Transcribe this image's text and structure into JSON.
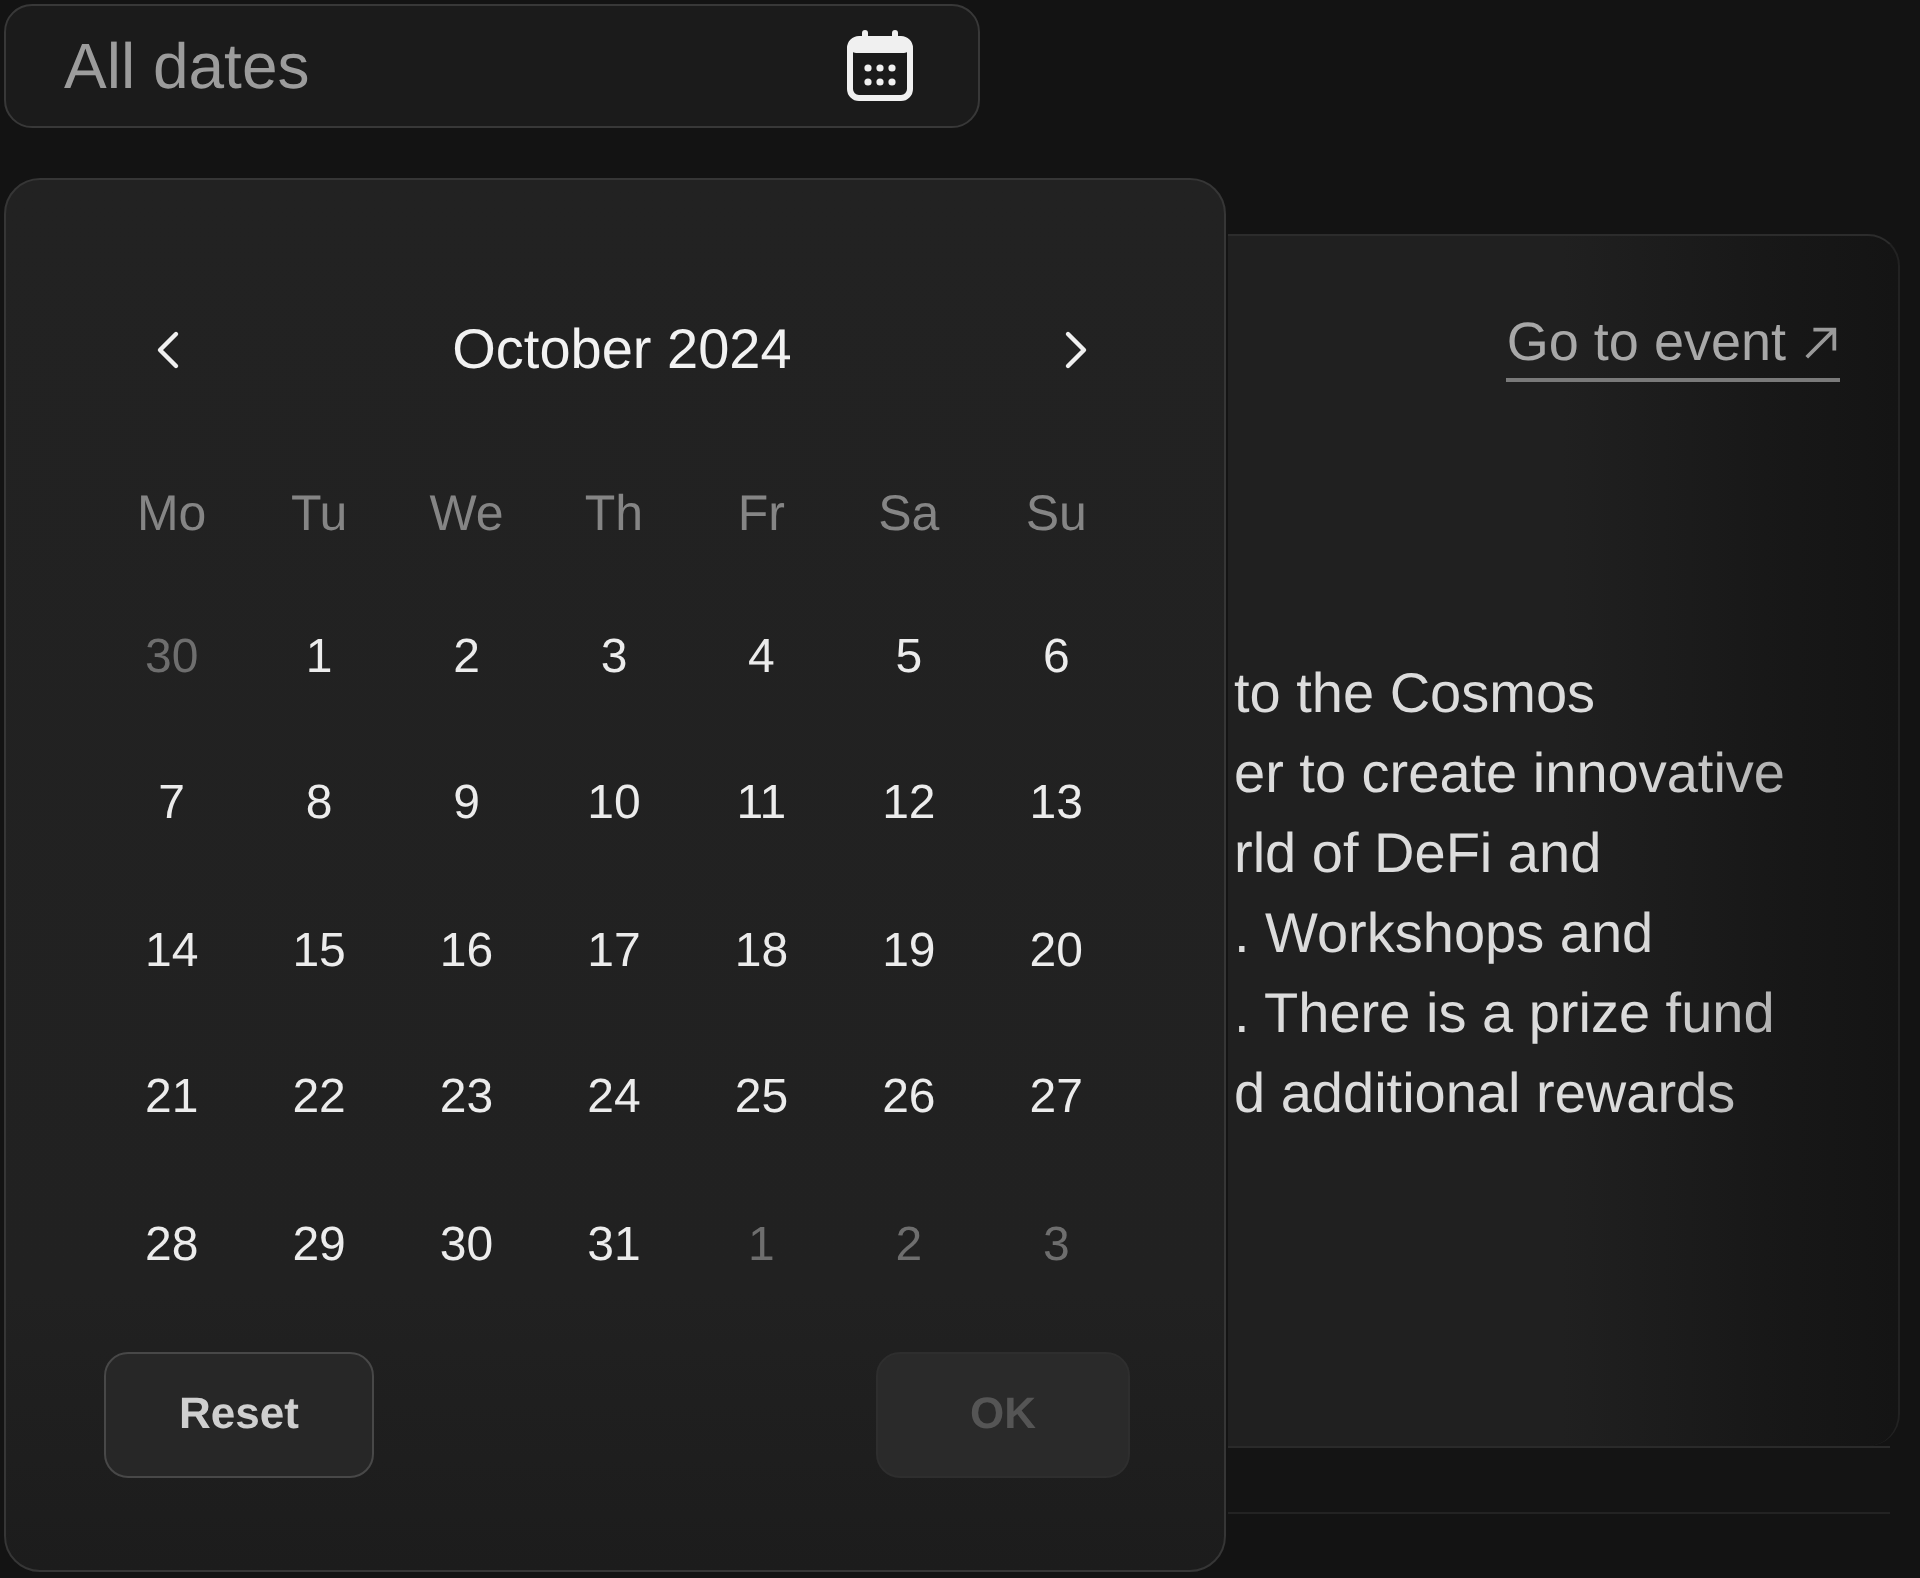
{
  "date_field": {
    "placeholder": "All dates"
  },
  "event_card": {
    "link": "Go to event",
    "description_lines": [
      "to the Cosmos",
      "er to create innovative",
      "rld of DeFi and",
      ". Workshops and",
      ". There is a prize fund",
      "d additional rewards"
    ]
  },
  "calendar": {
    "month": "October 2024",
    "weekdays": [
      "Mo",
      "Tu",
      "We",
      "Th",
      "Fr",
      "Sa",
      "Su"
    ],
    "weeks": [
      {
        "days": [
          {
            "day": "30",
            "in_month": false,
            "selected": false
          },
          {
            "day": "1",
            "in_month": true,
            "selected": false
          },
          {
            "day": "2",
            "in_month": true,
            "selected": false
          },
          {
            "day": "3",
            "in_month": true,
            "selected": false
          },
          {
            "day": "4",
            "in_month": true,
            "selected": false
          },
          {
            "day": "5",
            "in_month": true,
            "selected": false
          },
          {
            "day": "6",
            "in_month": true,
            "selected": false
          }
        ]
      },
      {
        "days": [
          {
            "day": "7",
            "in_month": true,
            "selected": false
          },
          {
            "day": "8",
            "in_month": true,
            "selected": false
          },
          {
            "day": "9",
            "in_month": true,
            "selected": false
          },
          {
            "day": "10",
            "in_month": true,
            "selected": false
          },
          {
            "day": "11",
            "in_month": true,
            "selected": false
          },
          {
            "day": "12",
            "in_month": true,
            "selected": false
          },
          {
            "day": "13",
            "in_month": true,
            "selected": false
          }
        ]
      },
      {
        "days": [
          {
            "day": "14",
            "in_month": true,
            "selected": false
          },
          {
            "day": "15",
            "in_month": true,
            "selected": false
          },
          {
            "day": "16",
            "in_month": true,
            "selected": false
          },
          {
            "day": "17",
            "in_month": true,
            "selected": false
          },
          {
            "day": "18",
            "in_month": true,
            "selected": false
          },
          {
            "day": "19",
            "in_month": true,
            "selected": false
          },
          {
            "day": "20",
            "in_month": true,
            "selected": false
          }
        ]
      },
      {
        "days": [
          {
            "day": "21",
            "in_month": true,
            "selected": false
          },
          {
            "day": "22",
            "in_month": true,
            "selected": false
          },
          {
            "day": "23",
            "in_month": true,
            "selected": false
          },
          {
            "day": "24",
            "in_month": true,
            "selected": false
          },
          {
            "day": "25",
            "in_month": true,
            "selected": false
          },
          {
            "day": "26",
            "in_month": true,
            "selected": false
          },
          {
            "day": "27",
            "in_month": true,
            "selected": false
          }
        ]
      },
      {
        "days": [
          {
            "day": "28",
            "in_month": true,
            "selected": false
          },
          {
            "day": "29",
            "in_month": true,
            "selected": false
          },
          {
            "day": "30",
            "in_month": true,
            "selected": false
          },
          {
            "day": "31",
            "in_month": true,
            "selected": false
          },
          {
            "day": "1",
            "in_month": false,
            "selected": false
          },
          {
            "day": "2",
            "in_month": false,
            "selected": false
          },
          {
            "day": "3",
            "in_month": false,
            "selected": false
          }
        ]
      }
    ],
    "buttons": [
      {
        "label": "Reset",
        "disabled": false
      },
      {
        "label": "OK",
        "disabled": true
      }
    ]
  }
}
